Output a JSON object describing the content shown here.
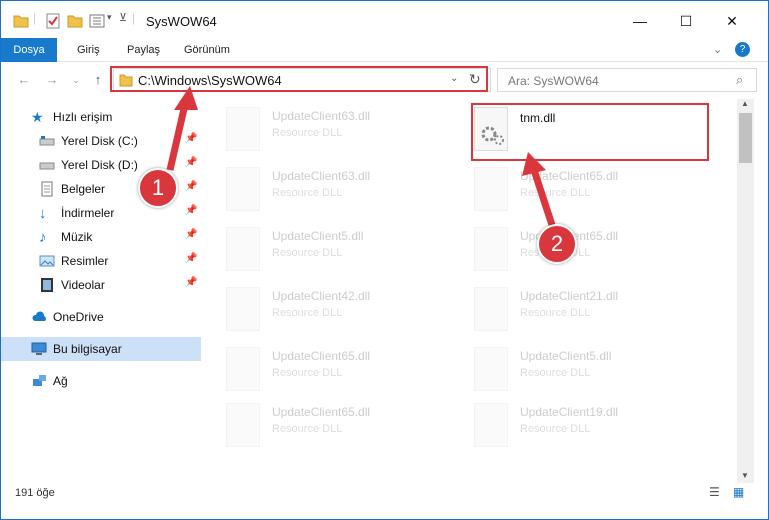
{
  "window": {
    "title": "SysWOW64"
  },
  "ribbon": {
    "tabs": [
      "Dosya",
      "Giriş",
      "Paylaş",
      "Görünüm"
    ]
  },
  "address": {
    "path": "C:\\Windows\\SysWOW64"
  },
  "search": {
    "placeholder": "Ara: SysWOW64"
  },
  "nav": {
    "quick_access": "Hızlı erişim",
    "items": [
      "Yerel Disk (C:)",
      "Yerel Disk (D:)",
      "Belgeler",
      "İndirmeler",
      "Müzik",
      "Resimler",
      "Videolar"
    ],
    "onedrive": "OneDrive",
    "this_pc": "Bu bilgisayar",
    "network": "Ağ"
  },
  "files": {
    "left": [
      {
        "name": "UpdateClient63.dll",
        "type": "Resource DLL"
      },
      {
        "name": "UpdateClient63.dll",
        "type": "Resource DLL"
      },
      {
        "name": "UpdateClient5.dll",
        "type": "Resource DLL"
      },
      {
        "name": "UpdateClient42.dll",
        "type": "Resource DLL"
      },
      {
        "name": "UpdateClient65.dll",
        "type": "Resource DLL"
      },
      {
        "name": "UpdateClient65.dll",
        "type": "Resource DLL"
      }
    ],
    "right": [
      {
        "name": "tnm.dll",
        "type": ""
      },
      {
        "name": "UpdateClient65.dll",
        "type": "Resource DLL"
      },
      {
        "name": "UpdateClient65.dll",
        "type": "Resource DLL"
      },
      {
        "name": "UpdateClient21.dll",
        "type": "Resource DLL"
      },
      {
        "name": "UpdateClient5.dll",
        "type": "Resource DLL"
      },
      {
        "name": "UpdateClient19.dll",
        "type": "Resource DLL"
      }
    ]
  },
  "status": {
    "count": "191 öğe"
  },
  "callouts": {
    "one": "1",
    "two": "2"
  },
  "colors": {
    "accent": "#1979ca",
    "highlight": "#d9363e"
  }
}
